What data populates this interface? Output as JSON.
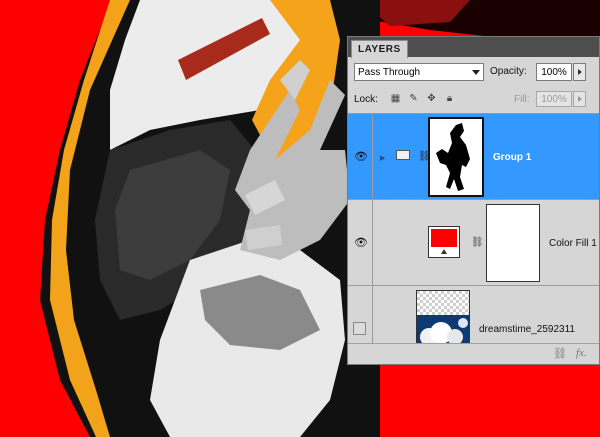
{
  "panel": {
    "tab_label": "LAYERS",
    "blend_mode": "Pass Through",
    "opacity_label": "Opacity:",
    "opacity_value": "100%",
    "lock_label": "Lock:",
    "fill_label": "Fill:",
    "fill_value": "100%"
  },
  "layers": [
    {
      "name": "Group 1",
      "type": "group",
      "selected": true,
      "visible": true
    },
    {
      "name": "Color Fill 1",
      "type": "fill",
      "selected": false,
      "visible": true,
      "fill_color": "#ff0000"
    },
    {
      "name": "dreamstime_2592311",
      "type": "image",
      "selected": false,
      "visible": false
    }
  ],
  "footer": {
    "link_icon": "link-icon",
    "fx_label": "fx."
  },
  "colors": {
    "canvas_background": "#ff0000",
    "selection": "#3399ff"
  }
}
